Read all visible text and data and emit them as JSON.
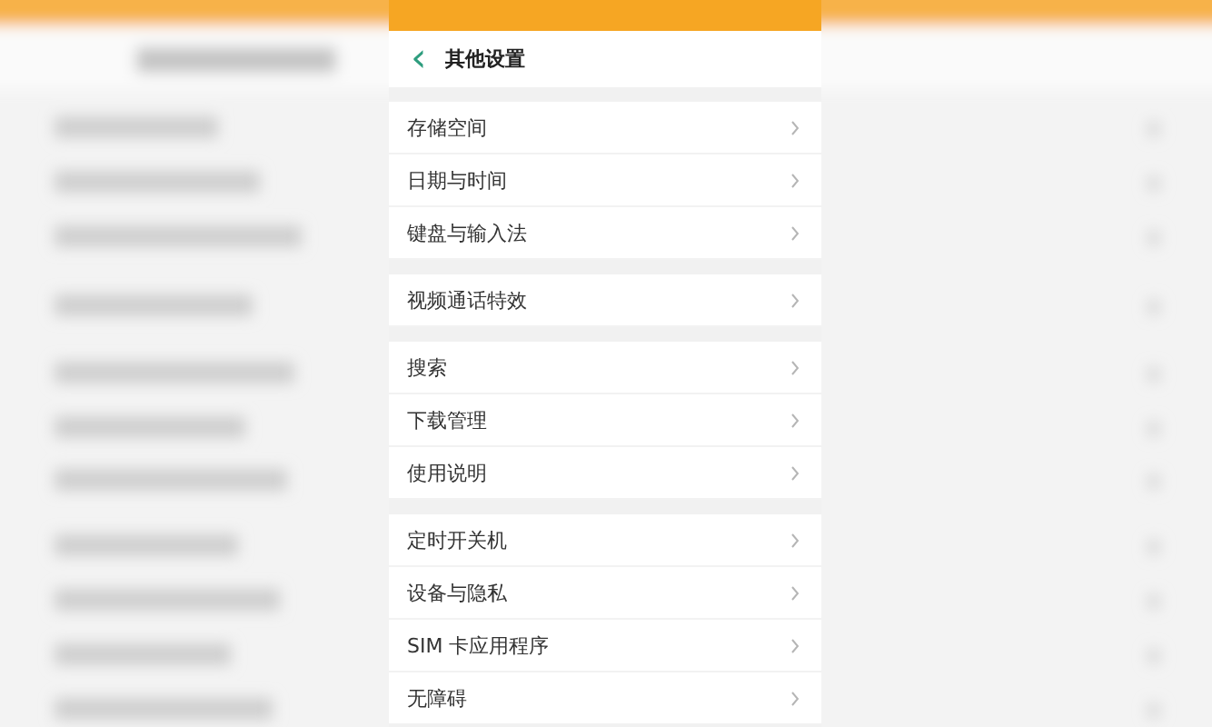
{
  "header": {
    "back_icon": "‹",
    "title": "其他设置"
  },
  "groups": [
    {
      "items": [
        {
          "label": "存储空间"
        },
        {
          "label": "日期与时间"
        },
        {
          "label": "键盘与输入法"
        }
      ]
    },
    {
      "items": [
        {
          "label": "视频通话特效"
        }
      ]
    },
    {
      "items": [
        {
          "label": "搜索"
        },
        {
          "label": "下载管理"
        },
        {
          "label": "使用说明"
        }
      ]
    },
    {
      "items": [
        {
          "label": "定时开关机"
        },
        {
          "label": "设备与隐私"
        },
        {
          "label": "SIM 卡应用程序"
        },
        {
          "label": "无障碍"
        }
      ]
    }
  ]
}
